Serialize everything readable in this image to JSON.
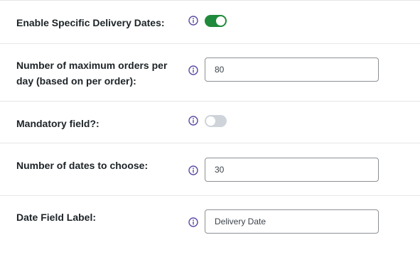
{
  "accent_color": "#1f8a3b",
  "info_icon_color": "#5b4ba3",
  "fields": {
    "specific_dates": {
      "label": "Enable Specific Delivery Dates:",
      "toggle_on": true
    },
    "max_orders": {
      "label": "Number of maximum orders per day (based on per order):",
      "value": "80"
    },
    "mandatory": {
      "label": "Mandatory field?:",
      "toggle_on": false
    },
    "dates_to_choose": {
      "label": "Number of dates to choose:",
      "value": "30"
    },
    "date_field_label": {
      "label": "Date Field Label:",
      "value": "Delivery Date"
    }
  }
}
